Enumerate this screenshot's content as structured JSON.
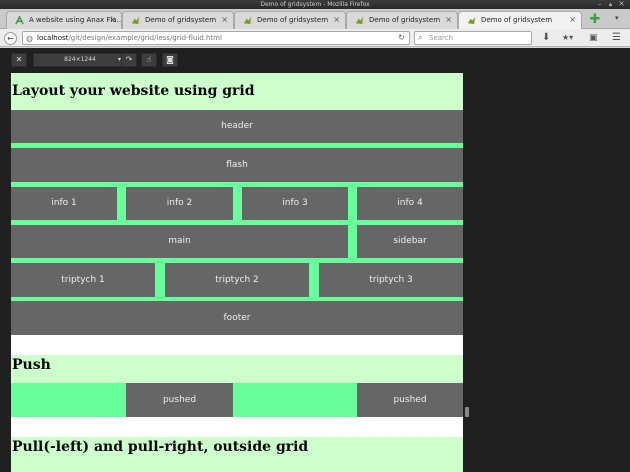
{
  "window": {
    "title": "Demo of gridsystem - Mozilla Firefox"
  },
  "tabs": [
    {
      "label": "A website using Anax Fla...",
      "icon": "anax-icon"
    },
    {
      "label": "Demo of gridsystem",
      "icon": "gridsystem-icon"
    },
    {
      "label": "Demo of gridsystem",
      "icon": "gridsystem-icon"
    },
    {
      "label": "Demo of gridsystem",
      "icon": "gridsystem-icon"
    },
    {
      "label": "Demo of gridsystem",
      "icon": "gridsystem-icon",
      "active": true
    }
  ],
  "nav": {
    "url_host": "localhost",
    "url_path": "/git/design/example/grid/less/grid-fluid.html",
    "search_placeholder": "Search"
  },
  "rdm": {
    "size": "824×1244"
  },
  "page": {
    "heading1": "Layout your website using grid",
    "header": "header",
    "flash": "flash",
    "info": [
      "info 1",
      "info 2",
      "info 3",
      "info 4"
    ],
    "main": "main",
    "sidebar": "sidebar",
    "triptych": [
      "triptych 1",
      "triptych 2",
      "triptych 3"
    ],
    "footer": "footer",
    "heading2": "Push",
    "pushed": [
      "pushed",
      "pushed"
    ],
    "heading3": "Pull(-left) and pull-right, outside grid"
  },
  "colors": {
    "cell": "#666666",
    "gap": "#66ff99",
    "heading_bg": "#ccffcc"
  }
}
